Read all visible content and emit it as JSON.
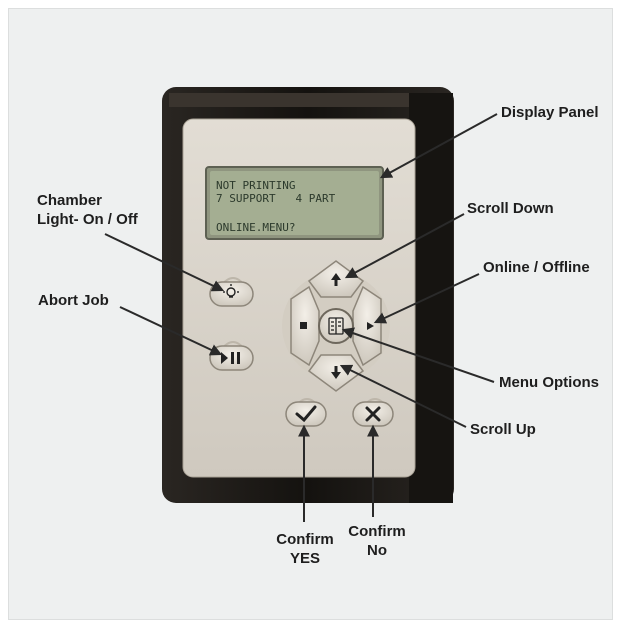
{
  "lcd": {
    "line1": "NOT PRINTING",
    "line2": "7 SUPPORT   4 PART",
    "line3": "ONLINE.MENU?"
  },
  "labels": {
    "display_panel": "Display Panel",
    "chamber_light_line1": "Chamber",
    "chamber_light_line2": "Light- On / Off",
    "scroll_down": "Scroll Down",
    "online_offline": "Online / Offline",
    "abort_job": "Abort Job",
    "menu_options": "Menu Options",
    "scroll_up": "Scroll Up",
    "confirm_yes_line1": "Confirm",
    "confirm_yes_line2": "YES",
    "confirm_no_line1": "Confirm",
    "confirm_no_line2": "No"
  },
  "colors": {
    "bezel": "#1c1a18",
    "faceplate": "#d9d4cc",
    "lcd": "#a4ae92",
    "arrow": "#2a2a2a"
  }
}
